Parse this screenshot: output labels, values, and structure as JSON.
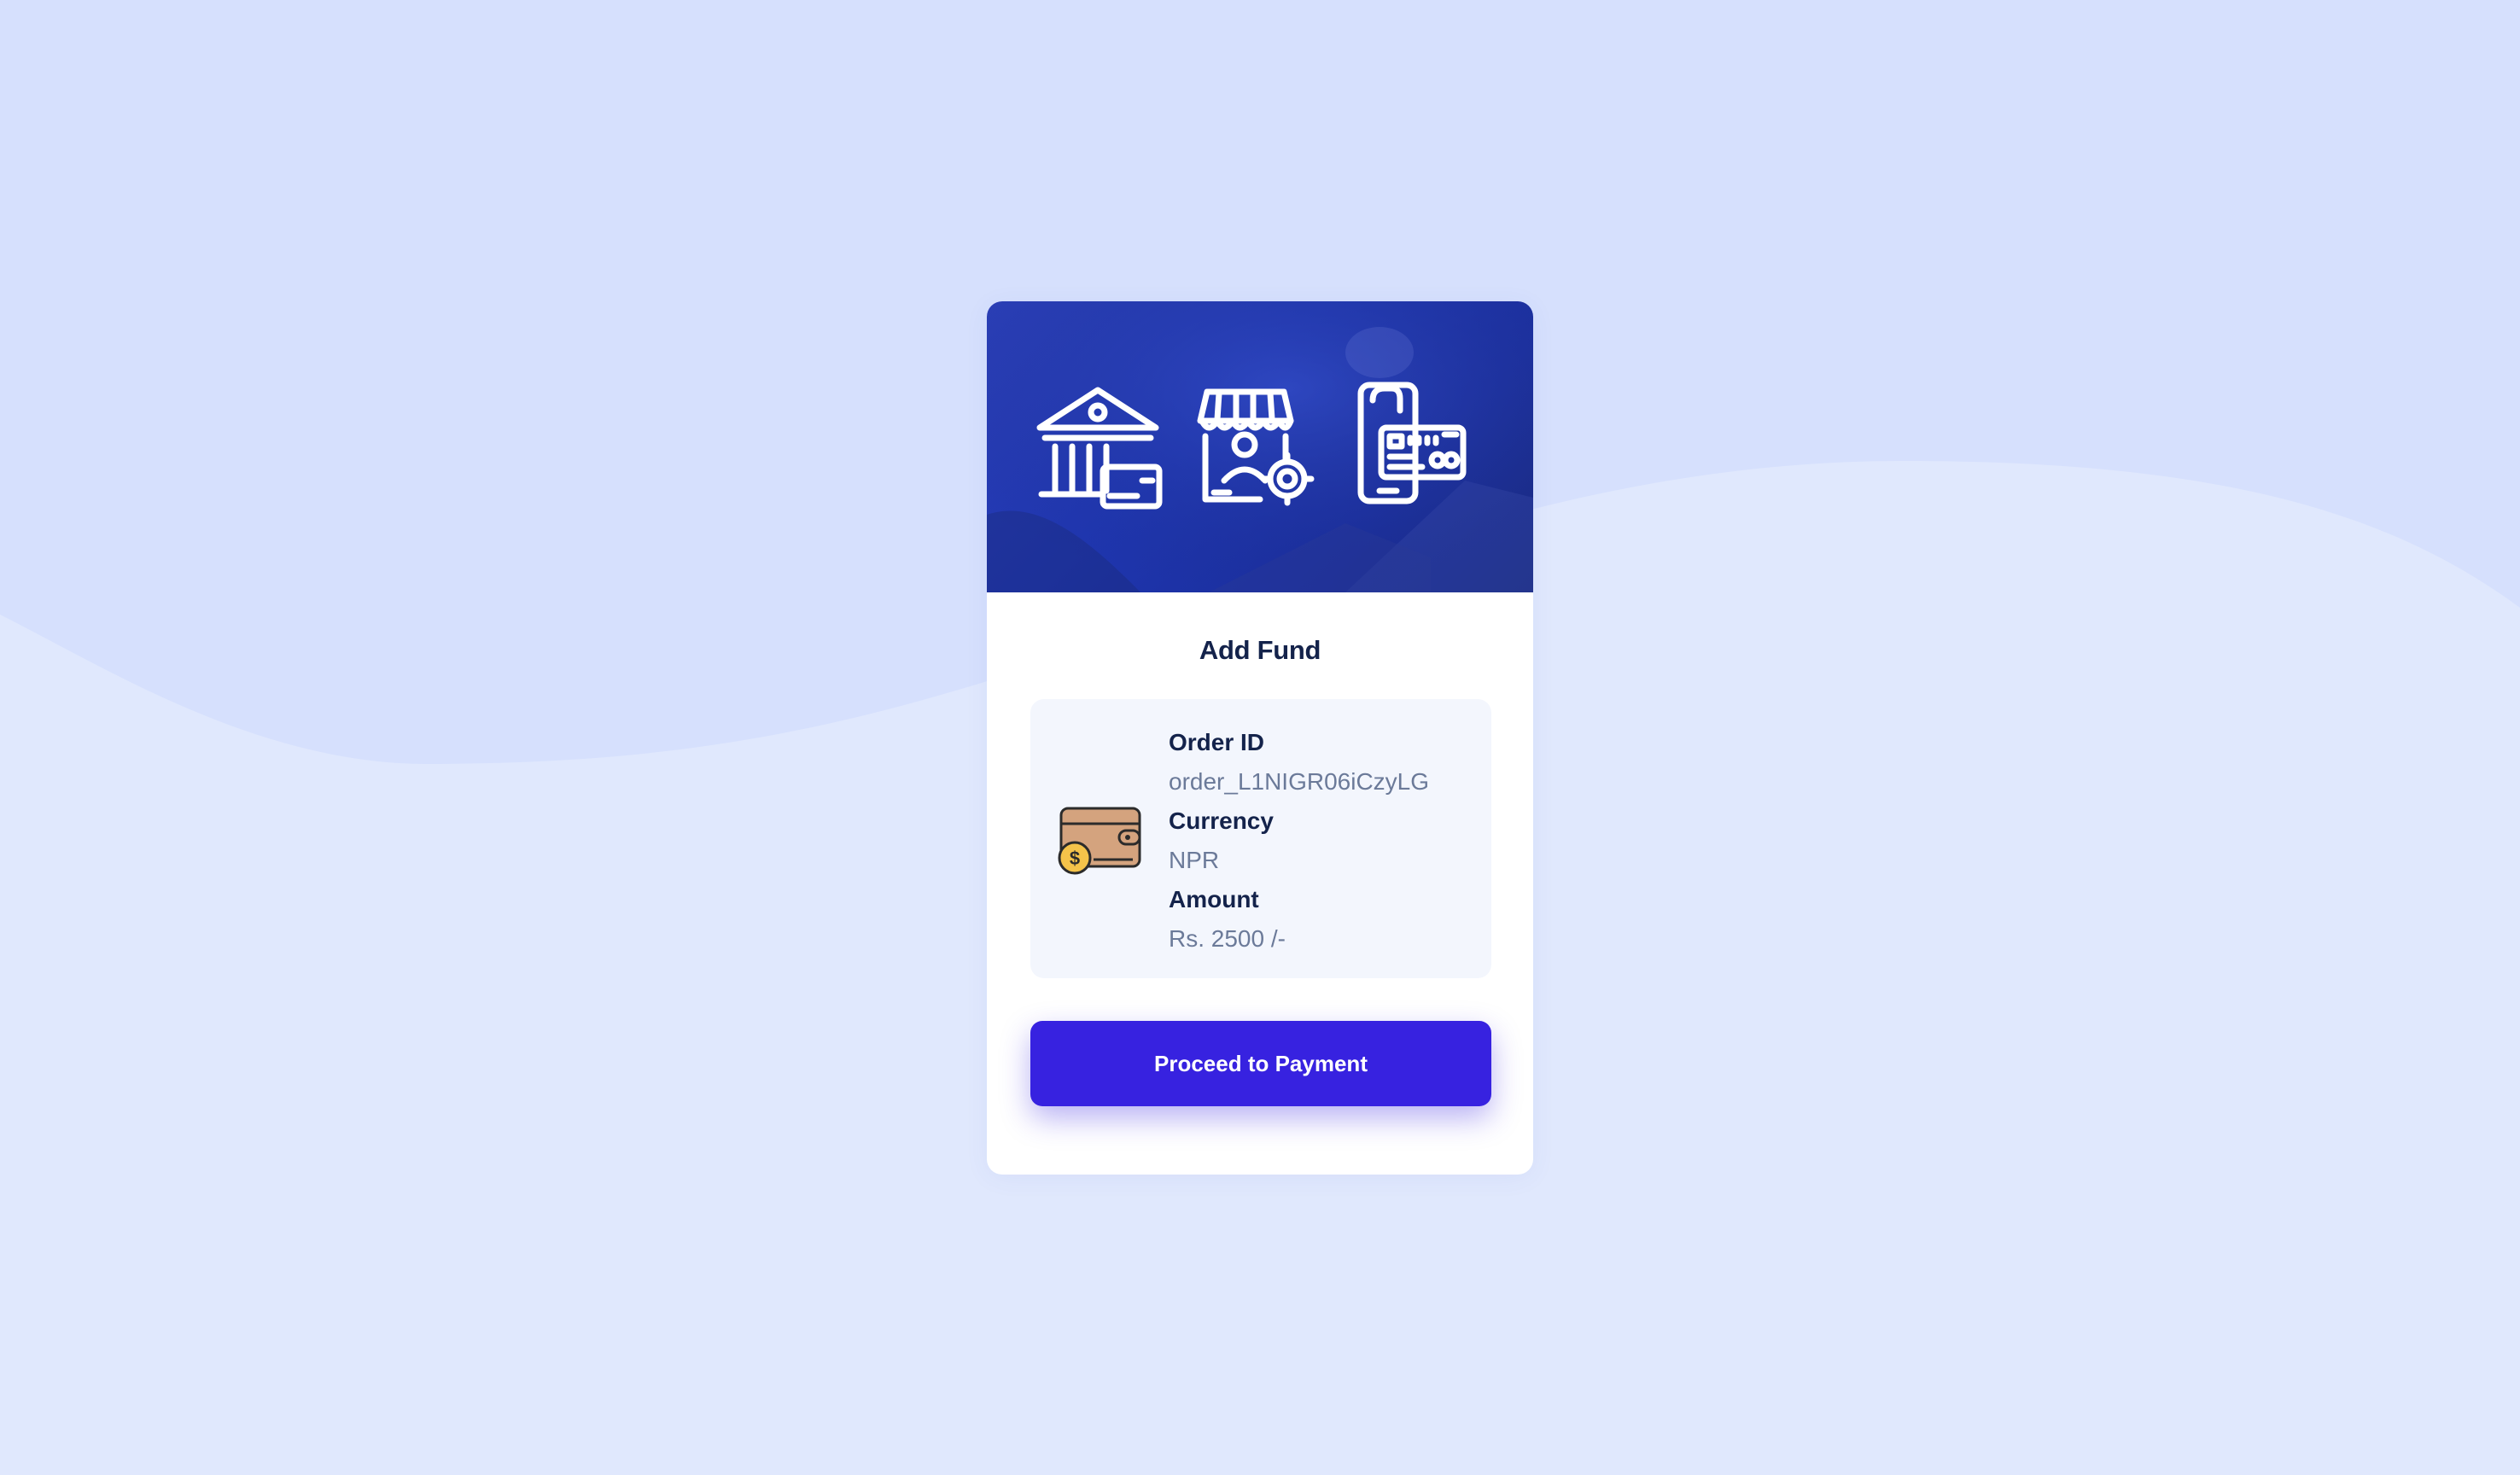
{
  "page": {
    "background_color": "#e0e8fd",
    "wave_color": "#d6e0fd"
  },
  "card": {
    "banner_icons": [
      "bank-card-icon",
      "shop-settings-icon",
      "mobile-card-payment-icon"
    ],
    "title": "Add Fund",
    "details": {
      "icon": "wallet-coin-icon",
      "order_id_label": "Order ID",
      "order_id_value": "order_L1NIGR06iCzyLG",
      "currency_label": "Currency",
      "currency_value": "NPR",
      "amount_label": "Amount",
      "amount_value": "Rs. 2500 /-"
    },
    "button": {
      "label": "Proceed to Payment",
      "color": "#3722e0"
    }
  }
}
